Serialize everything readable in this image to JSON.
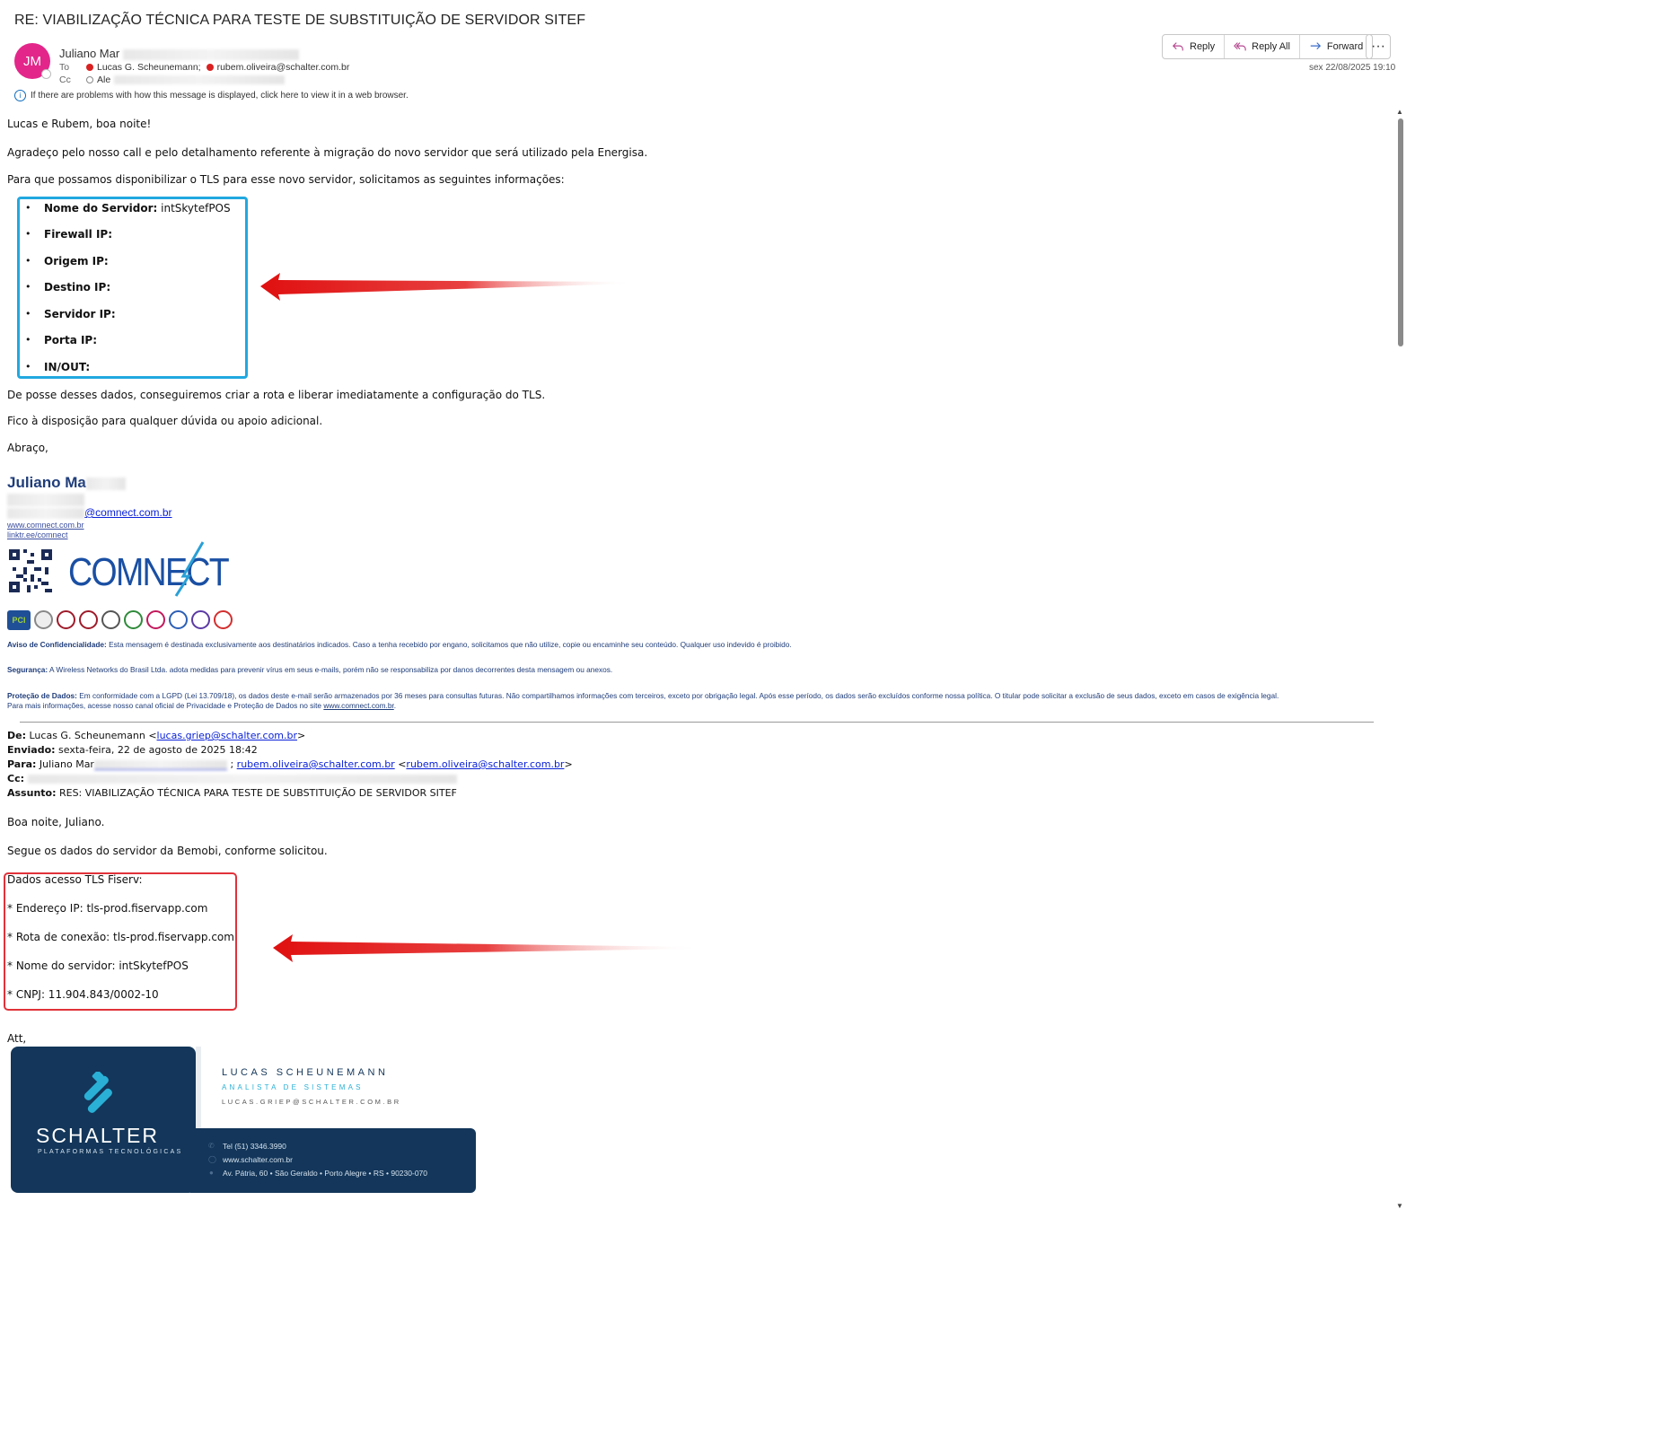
{
  "email": {
    "subject": "RE: VIABILIZAÇÃO TÉCNICA PARA TESTE DE SUBSTITUIÇÃO DE SERVIDOR SITEF",
    "avatar_initials": "JM",
    "sender_visible": "Juliano Mar",
    "to_label": "To",
    "cc_label": "Cc",
    "to": [
      "Lucas G. Scheunemann;",
      "rubem.oliveira@schalter.com.br"
    ],
    "cc_visible": "Ale",
    "info_text": "If there are problems with how this message is displayed, click here to view it in a web browser.",
    "date": "sex 22/08/2025 19:10"
  },
  "toolbar": {
    "reply": "Reply",
    "reply_all": "Reply All",
    "forward": "Forward",
    "more": "···"
  },
  "reply_body": {
    "greeting": "Lucas e Rubem, boa noite!",
    "p1": "Agradeço pelo nosso call e pelo detalhamento referente à migração do novo servidor que será utilizado pela Energisa.",
    "p2": "Para que possamos disponibilizar o TLS para esse novo servidor, solicitamos as seguintes informações:",
    "fields": [
      {
        "label": "Nome do Servidor:",
        "value": " intSkytefPOS"
      },
      {
        "label": "Firewall IP:",
        "value": ""
      },
      {
        "label": "Origem IP:",
        "value": ""
      },
      {
        "label": "Destino IP:",
        "value": ""
      },
      {
        "label": "Servidor IP:",
        "value": ""
      },
      {
        "label": "Porta IP:",
        "value": ""
      },
      {
        "label": "IN/OUT:",
        "value": ""
      }
    ],
    "p3": "De posse desses dados, conseguiremos criar a rota e liberar imediatamente a configuração do TLS.",
    "p4": "Fico à disposição para qualquer dúvida ou apoio adicional.",
    "closing": "Abraço,"
  },
  "signature": {
    "name_visible": "Juliano Ma",
    "email_domain": "@comnect.com.br",
    "site": "www.comnect.com.br",
    "linktree": "linktr.ee/comnect",
    "logo_text": "COMNECT",
    "badges": [
      "PCI DSS",
      "ISO",
      "GDPR",
      "CYBER",
      "CSI",
      "ANATEL",
      "ISO",
      "ISO",
      "LGPD"
    ]
  },
  "disclaimer": {
    "conf_label": "Aviso de Confidencialidade:",
    "conf_text": " Esta mensagem é destinada exclusivamente aos destinatários indicados. Caso a tenha recebido por engano, solicitamos que não utilize, copie ou encaminhe seu conteúdo. Qualquer uso indevido é proibido.",
    "sec_label": "Segurança:",
    "sec_text": " A Wireless Networks do Brasil Ltda. adota medidas para prevenir vírus em seus e-mails, porém não se responsabiliza por danos decorrentes desta mensagem ou anexos.",
    "data_label": "Proteção de Dados:",
    "data_text": " Em conformidade com a LGPD (Lei 13.709/18), os dados deste e-mail serão armazenados por 36 meses para consultas futuras. Não compartilhamos informações com terceiros, exceto por obrigação legal. Após esse período, os dados serão excluídos conforme nossa política. O titular pode solicitar a exclusão de seus dados, exceto em casos de exigência legal.",
    "data_text2": "Para mais informações, acesse nosso canal oficial de Privacidade e Proteção de Dados no site ",
    "data_link": "www.comnect.com.br",
    "data_end": "."
  },
  "quoted": {
    "de_label": "De:",
    "de_name": " Lucas G. Scheunemann <",
    "de_email": "lucas.griep@schalter.com.br",
    "de_end": ">",
    "enviado_label": "Enviado:",
    "enviado": " sexta-feira, 22 de agosto de 2025 18:42",
    "para_label": "Para:",
    "para_name": " Juliano Mar",
    "para_sep": " ; ",
    "para_email1": "rubem.oliveira@schalter.com.br",
    "para_open": " <",
    "para_email2": "rubem.oliveira@schalter.com.br",
    "para_close": ">",
    "cc_label": "Cc:",
    "assunto_label": "Assunto:",
    "assunto": " RES: VIABILIZAÇÃO TÉCNICA PARA TESTE DE SUBSTITUIÇÃO DE SERVIDOR SITEF",
    "greeting": "Boa noite, Juliano.",
    "p1": "Segue os dados do servidor da Bemobi, conforme solicitou.",
    "tls_title": "Dados acesso TLS Fiserv:",
    "tls_items": [
      "* Endereço IP: tls-prod.fiservapp.com",
      "* Rota de conexão: tls-prod.fiservapp.com",
      "* Nome do servidor: intSkytefPOS",
      "* CNPJ: 11.904.843/0002-10"
    ],
    "closing": "Att,"
  },
  "schalter_card": {
    "brand": "SCHALTER",
    "tagline": "PLATAFORMAS TECNOLÓGICAS",
    "name": "LUCAS SCHEUNEMANN",
    "role": "ANALISTA DE SISTEMAS",
    "email": "LUCAS.GRIEP@SCHALTER.COM.BR",
    "phone": "Tel (51) 3346.3990",
    "site": "www.schalter.com.br",
    "address": "Av. Pátria, 60 • São Geraldo • Porto Alegre • RS • 90230-070"
  },
  "colors": {
    "avatar": "#e3268a",
    "highlight_box_blue": "#22a8e0",
    "highlight_box_red": "#e0323a",
    "arrow": "#e01010",
    "signature_blue": "#1f3d7a",
    "schalter_navy": "#13365a",
    "schalter_teal": "#2ab0d6"
  }
}
